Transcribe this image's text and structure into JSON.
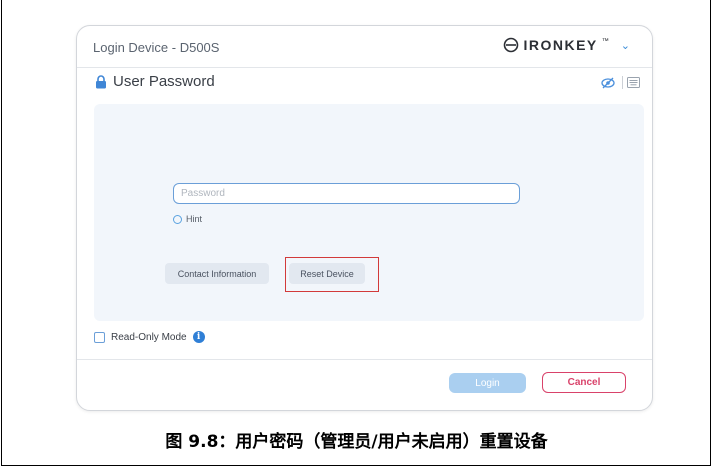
{
  "window": {
    "title": "Login Device - D500S",
    "brand": "IRONKEY",
    "brand_tm": "™"
  },
  "section": {
    "title": "User Password"
  },
  "form": {
    "password_placeholder": "Password",
    "hint_label": "Hint",
    "contact_button": "Contact Information",
    "reset_button": "Reset Device"
  },
  "footer": {
    "readonly_label": "Read-Only Mode",
    "info_glyph": "i",
    "login_button": "Login",
    "cancel_button": "Cancel"
  },
  "caption": "图 9.8：用户密码（管理员/用户未启用）重置设备",
  "colors": {
    "accent": "#2f7fd6",
    "cancel": "#d9426a",
    "highlight": "#d23a3a",
    "panel": "#f2f6fb"
  }
}
